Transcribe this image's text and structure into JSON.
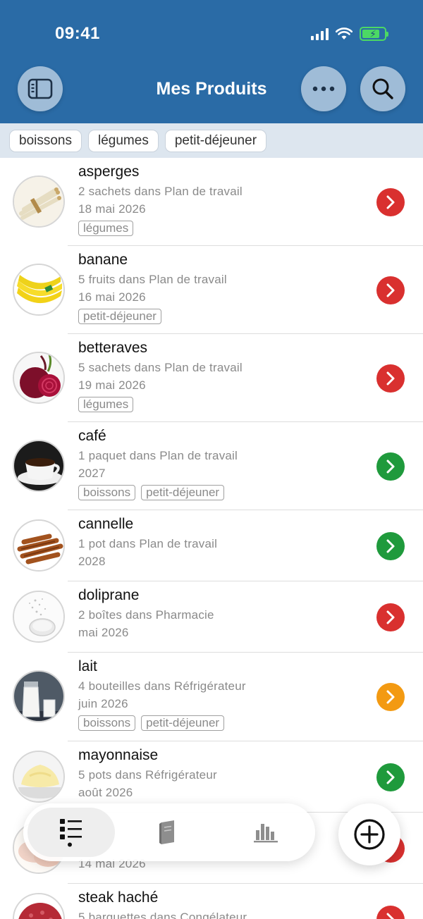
{
  "status": {
    "time": "09:41"
  },
  "header": {
    "title": "Mes Produits"
  },
  "filters": [
    "boissons",
    "légumes",
    "petit-déjeuner"
  ],
  "items": [
    {
      "name": "asperges",
      "qty": "2 sachets dans Plan de travail",
      "date": "18 mai 2026",
      "tags": [
        "légumes"
      ],
      "status": "#d9302f",
      "thumb": "asparagus"
    },
    {
      "name": "banane",
      "qty": "5 fruits dans Plan de travail",
      "date": "16 mai 2026",
      "tags": [
        "petit-déjeuner"
      ],
      "status": "#d9302f",
      "thumb": "banana"
    },
    {
      "name": "betteraves",
      "qty": "5 sachets dans Plan de travail",
      "date": "19 mai 2026",
      "tags": [
        "légumes"
      ],
      "status": "#d9302f",
      "thumb": "beet"
    },
    {
      "name": "café",
      "qty": "1 paquet dans Plan de travail",
      "date": "2027",
      "tags": [
        "boissons",
        "petit-déjeuner"
      ],
      "status": "#1f9a3c",
      "thumb": "coffee"
    },
    {
      "name": "cannelle",
      "qty": "1 pot dans Plan de travail",
      "date": "2028",
      "tags": [],
      "status": "#1f9a3c",
      "thumb": "cinnamon"
    },
    {
      "name": "doliprane",
      "qty": "2 boîtes dans Pharmacie",
      "date": "mai 2026",
      "tags": [],
      "status": "#d9302f",
      "thumb": "pill"
    },
    {
      "name": "lait",
      "qty": "4 bouteilles dans Réfrigérateur",
      "date": "juin 2026",
      "tags": [
        "boissons",
        "petit-déjeuner"
      ],
      "status": "#f39a12",
      "thumb": "milk"
    },
    {
      "name": "mayonnaise",
      "qty": "5 pots dans Réfrigérateur",
      "date": "août 2026",
      "tags": [],
      "status": "#1f9a3c",
      "thumb": "mayo"
    },
    {
      "name": "",
      "qty": "",
      "date": "14 mai 2026",
      "tags": [],
      "status": "#d9302f",
      "thumb": "chicken"
    },
    {
      "name": "steak haché",
      "qty": "5 barquettes dans Congélateur",
      "date": "",
      "tags": [],
      "status": "#d9302f",
      "thumb": "steak"
    }
  ],
  "colors": {
    "header": "#2a6ba6",
    "red": "#d9302f",
    "green": "#1f9a3c",
    "orange": "#f39a12"
  },
  "tabbar": {
    "tabs": [
      "list-icon",
      "book-icon",
      "chart-icon"
    ],
    "action": "add-circle-icon"
  }
}
